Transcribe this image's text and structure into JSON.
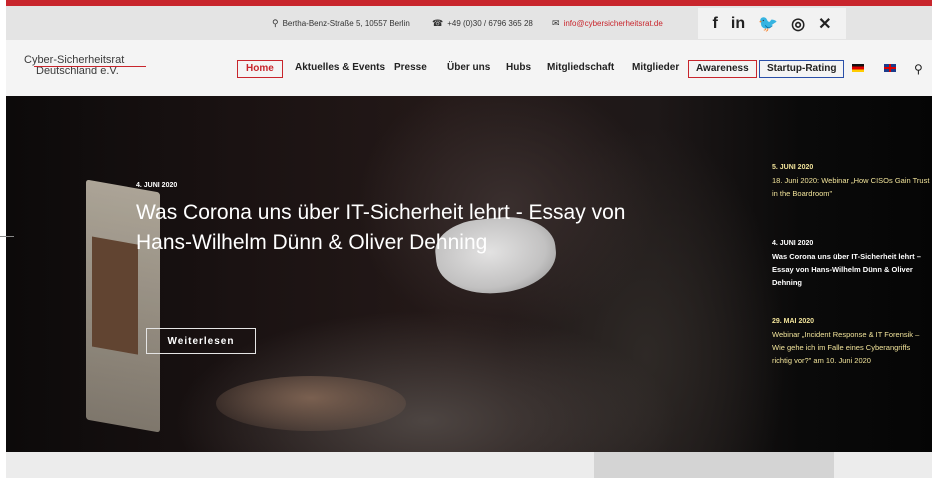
{
  "topbar": {
    "address": "Bertha-Benz-Straße 5, 10557 Berlin",
    "phone": "+49 (0)30 / 6796 365 28",
    "email": "info@cybersicherheitsrat.de"
  },
  "social": {
    "facebook": "f",
    "linkedin": "in",
    "twitter": "🐦",
    "instagram": "◎",
    "xing": "✕"
  },
  "logo": {
    "line1": "Cyber-Sicherheitsrat",
    "line2": "Deutschland e.V."
  },
  "nav": {
    "items": [
      "Home",
      "Aktuelles & Events",
      "Presse",
      "Über uns",
      "Hubs",
      "Mitgliedschaft",
      "Mitglieder",
      "Awareness",
      "Startup-Rating"
    ]
  },
  "hero": {
    "date": "4. JUNI 2020",
    "title": "Was Corona uns über IT-Sicherheit lehrt - Essay von Hans-Wilhelm Dünn & Oliver Dehning",
    "button": "Weiterlesen"
  },
  "sidebar": {
    "posts": [
      {
        "date": "5. JUNI 2020",
        "text": "18. Juni 2020: Webinar „How CISOs Gain Trust in the Boardroom\""
      },
      {
        "date": "4. JUNI 2020",
        "text": "Was Corona uns über IT-Sicherheit lehrt – Essay von Hans-Wilhelm Dünn & Oliver Dehning"
      },
      {
        "date": "29. MAI 2020",
        "text": "Webinar „Incident Response & IT Forensik – Wie gehe ich im Falle eines Cyberangriffs richtig vor?\" am 10. Juni 2020"
      }
    ]
  },
  "colors": {
    "accent_red": "#c8252c",
    "accent_blue": "#2a4fa8",
    "side_text": "#f1e39a"
  }
}
